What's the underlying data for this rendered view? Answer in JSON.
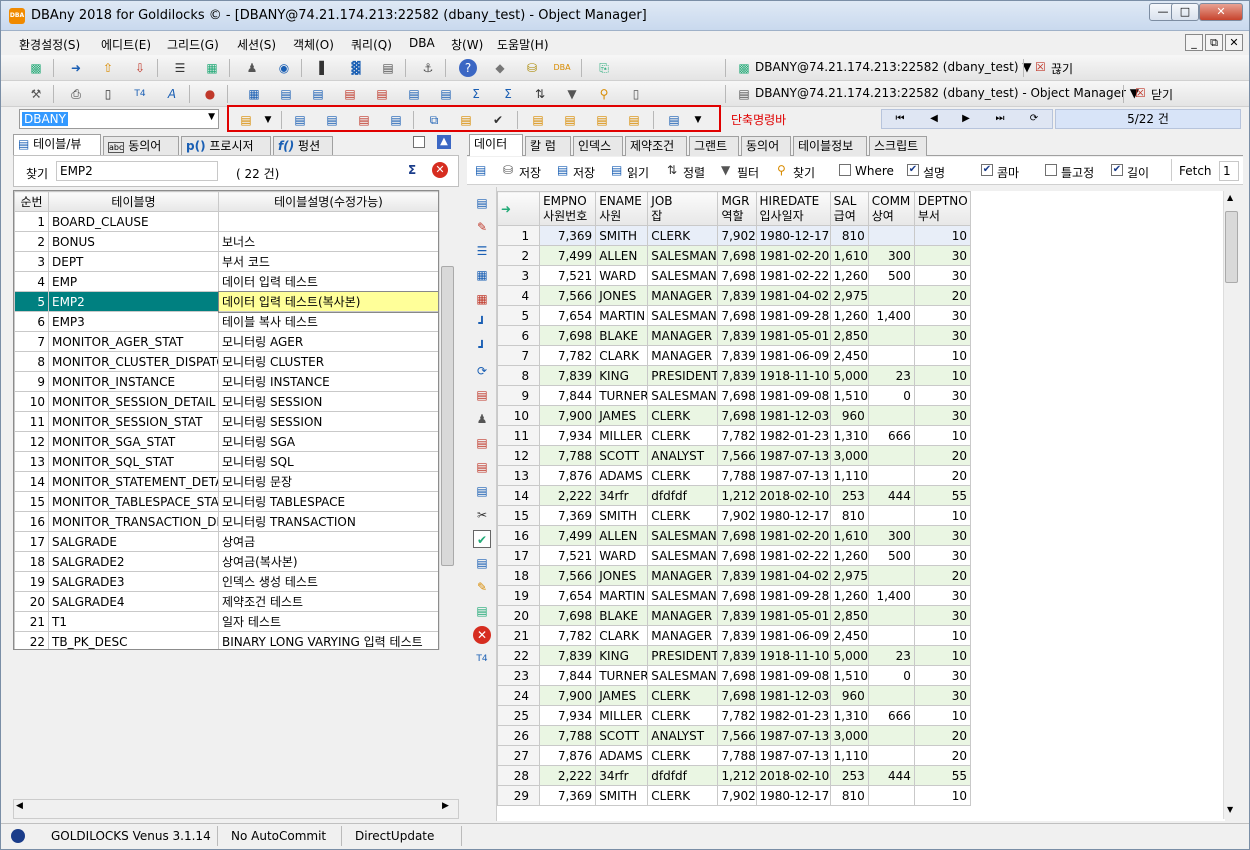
{
  "window": {
    "title": "DBAny 2018 for Goldilocks © - [DBANY@74.21.174.213:22582 (dbany_test) - Object Manager]",
    "app_icon_text": "DBA"
  },
  "menu": [
    "환경설정(S)",
    "에디트(E)",
    "그리드(G)",
    "세션(S)",
    "객체(O)",
    "쿼리(Q)",
    "DBA",
    "창(W)",
    "도움말(H)"
  ],
  "connection": {
    "current": "DBANY@74.21.174.213:22582 (dbany_test) ▼",
    "window": "DBANY@74.21.174.213:22582 (dbany_test) - Object Manager ▼",
    "disconnect_label": "끊기",
    "close_label": "닫기"
  },
  "schema": {
    "value": "DBANY"
  },
  "shortcut_bar_label": "단축명령바",
  "record_position": "5/22 건",
  "left": {
    "tabs": [
      "테이블/뷰",
      "동의어",
      "프로시저",
      "펑션"
    ],
    "search_label": "찾기",
    "search_value": "EMP2",
    "count": "( 22 건)",
    "columns": [
      "순번",
      "테이블명",
      "테이블설명(수정가능)"
    ],
    "rows": [
      [
        "1",
        "BOARD_CLAUSE",
        ""
      ],
      [
        "2",
        "BONUS",
        "보너스"
      ],
      [
        "3",
        "DEPT",
        "부서 코드"
      ],
      [
        "4",
        "EMP",
        "데이터 입력 테스트"
      ],
      [
        "5",
        "EMP2",
        "데이터 입력 테스트(복사본)"
      ],
      [
        "6",
        "EMP3",
        "테이블 복사 테스트"
      ],
      [
        "7",
        "MONITOR_AGER_STAT",
        "모니터링 AGER"
      ],
      [
        "8",
        "MONITOR_CLUSTER_DISPATCH",
        "모니터링 CLUSTER"
      ],
      [
        "9",
        "MONITOR_INSTANCE",
        "모니터링 INSTANCE"
      ],
      [
        "10",
        "MONITOR_SESSION_DETAIL",
        "모니터링 SESSION"
      ],
      [
        "11",
        "MONITOR_SESSION_STAT",
        "모니터링 SESSION"
      ],
      [
        "12",
        "MONITOR_SGA_STAT",
        "모니터링 SGA"
      ],
      [
        "13",
        "MONITOR_SQL_STAT",
        "모니터링 SQL"
      ],
      [
        "14",
        "MONITOR_STATEMENT_DETAIL",
        "모니터링 문장"
      ],
      [
        "15",
        "MONITOR_TABLESPACE_STAT",
        "모니터링 TABLESPACE"
      ],
      [
        "16",
        "MONITOR_TRANSACTION_DETA",
        "모니터링 TRANSACTION"
      ],
      [
        "17",
        "SALGRADE",
        "상여금"
      ],
      [
        "18",
        "SALGRADE2",
        "상여금(복사본)"
      ],
      [
        "19",
        "SALGRADE3",
        "인덱스 생성 테스트"
      ],
      [
        "20",
        "SALGRADE4",
        "제약조건 테스트"
      ],
      [
        "21",
        "T1",
        "일자 테스트"
      ],
      [
        "22",
        "TB_PK_DESC",
        "BINARY LONG VARYING 입력 테스트"
      ]
    ]
  },
  "right": {
    "tabs": [
      "데이터",
      "칼 럼",
      "인덱스",
      "제약조건",
      "그랜트",
      "동의어",
      "테이블정보",
      "스크립트"
    ],
    "toolbar": {
      "save1": "저장",
      "save2": "저장",
      "read": "읽기",
      "sort": "정렬",
      "filter": "필터",
      "find": "찾기",
      "where": "Where",
      "desc": "설명",
      "comma": "콤마",
      "fix": "틀고정",
      "length": "길이",
      "fetch_label": "Fetch",
      "fetch_value": "1"
    },
    "checks": {
      "where": false,
      "desc": true,
      "comma": true,
      "fix": false,
      "length": true
    },
    "columns": [
      [
        "EMPNO",
        "사원번호"
      ],
      [
        "ENAME",
        "사원"
      ],
      [
        "JOB",
        "잡"
      ],
      [
        "MGR",
        "역할"
      ],
      [
        "HIREDATE",
        "입사일자"
      ],
      [
        "SAL",
        "급여"
      ],
      [
        "COMM",
        "상여"
      ],
      [
        "DEPTNO",
        "부서"
      ]
    ],
    "rows": [
      [
        "1",
        "7,369",
        "SMITH",
        "CLERK",
        "7,902",
        "1980-12-17",
        "810",
        "",
        "10"
      ],
      [
        "2",
        "7,499",
        "ALLEN",
        "SALESMAN",
        "7,698",
        "1981-02-20",
        "1,610",
        "300",
        "30"
      ],
      [
        "3",
        "7,521",
        "WARD",
        "SALESMAN",
        "7,698",
        "1981-02-22",
        "1,260",
        "500",
        "30"
      ],
      [
        "4",
        "7,566",
        "JONES",
        "MANAGER",
        "7,839",
        "1981-04-02",
        "2,975",
        "",
        "20"
      ],
      [
        "5",
        "7,654",
        "MARTIN",
        "SALESMAN",
        "7,698",
        "1981-09-28",
        "1,260",
        "1,400",
        "30"
      ],
      [
        "6",
        "7,698",
        "BLAKE",
        "MANAGER",
        "7,839",
        "1981-05-01",
        "2,850",
        "",
        "30"
      ],
      [
        "7",
        "7,782",
        "CLARK",
        "MANAGER",
        "7,839",
        "1981-06-09",
        "2,450",
        "",
        "10"
      ],
      [
        "8",
        "7,839",
        "KING",
        "PRESIDENT",
        "7,839",
        "1918-11-10",
        "5,000",
        "23",
        "10"
      ],
      [
        "9",
        "7,844",
        "TURNER",
        "SALESMAN",
        "7,698",
        "1981-09-08",
        "1,510",
        "0",
        "30"
      ],
      [
        "10",
        "7,900",
        "JAMES",
        "CLERK",
        "7,698",
        "1981-12-03",
        "960",
        "",
        "30"
      ],
      [
        "11",
        "7,934",
        "MILLER",
        "CLERK",
        "7,782",
        "1982-01-23",
        "1,310",
        "666",
        "10"
      ],
      [
        "12",
        "7,788",
        "SCOTT",
        "ANALYST",
        "7,566",
        "1987-07-13",
        "3,000",
        "",
        "20"
      ],
      [
        "13",
        "7,876",
        "ADAMS",
        "CLERK",
        "7,788",
        "1987-07-13",
        "1,110",
        "",
        "20"
      ],
      [
        "14",
        "2,222",
        "34rfr",
        "dfdfdf",
        "1,212",
        "2018-02-10",
        "253",
        "444",
        "55"
      ],
      [
        "15",
        "7,369",
        "SMITH",
        "CLERK",
        "7,902",
        "1980-12-17",
        "810",
        "",
        "10"
      ],
      [
        "16",
        "7,499",
        "ALLEN",
        "SALESMAN",
        "7,698",
        "1981-02-20",
        "1,610",
        "300",
        "30"
      ],
      [
        "17",
        "7,521",
        "WARD",
        "SALESMAN",
        "7,698",
        "1981-02-22",
        "1,260",
        "500",
        "30"
      ],
      [
        "18",
        "7,566",
        "JONES",
        "MANAGER",
        "7,839",
        "1981-04-02",
        "2,975",
        "",
        "20"
      ],
      [
        "19",
        "7,654",
        "MARTIN",
        "SALESMAN",
        "7,698",
        "1981-09-28",
        "1,260",
        "1,400",
        "30"
      ],
      [
        "20",
        "7,698",
        "BLAKE",
        "MANAGER",
        "7,839",
        "1981-05-01",
        "2,850",
        "",
        "30"
      ],
      [
        "21",
        "7,782",
        "CLARK",
        "MANAGER",
        "7,839",
        "1981-06-09",
        "2,450",
        "",
        "10"
      ],
      [
        "22",
        "7,839",
        "KING",
        "PRESIDENT",
        "7,839",
        "1918-11-10",
        "5,000",
        "23",
        "10"
      ],
      [
        "23",
        "7,844",
        "TURNER",
        "SALESMAN",
        "7,698",
        "1981-09-08",
        "1,510",
        "0",
        "30"
      ],
      [
        "24",
        "7,900",
        "JAMES",
        "CLERK",
        "7,698",
        "1981-12-03",
        "960",
        "",
        "30"
      ],
      [
        "25",
        "7,934",
        "MILLER",
        "CLERK",
        "7,782",
        "1982-01-23",
        "1,310",
        "666",
        "10"
      ],
      [
        "26",
        "7,788",
        "SCOTT",
        "ANALYST",
        "7,566",
        "1987-07-13",
        "3,000",
        "",
        "20"
      ],
      [
        "27",
        "7,876",
        "ADAMS",
        "CLERK",
        "7,788",
        "1987-07-13",
        "1,110",
        "",
        "20"
      ],
      [
        "28",
        "2,222",
        "34rfr",
        "dfdfdf",
        "1,212",
        "2018-02-10",
        "253",
        "444",
        "55"
      ],
      [
        "29",
        "7,369",
        "SMITH",
        "CLERK",
        "7,902",
        "1980-12-17",
        "810",
        "",
        "10"
      ]
    ]
  },
  "status": {
    "db": "GOLDILOCKS Venus 3.1.14",
    "commit": "No AutoCommit",
    "update": "DirectUpdate"
  },
  "colors": {
    "selected_row": "#008080",
    "selected_cell": "#ffff99",
    "alt_row": "#eaf6e3",
    "red_box": "#e00000",
    "accent": "#1a3c8a"
  }
}
